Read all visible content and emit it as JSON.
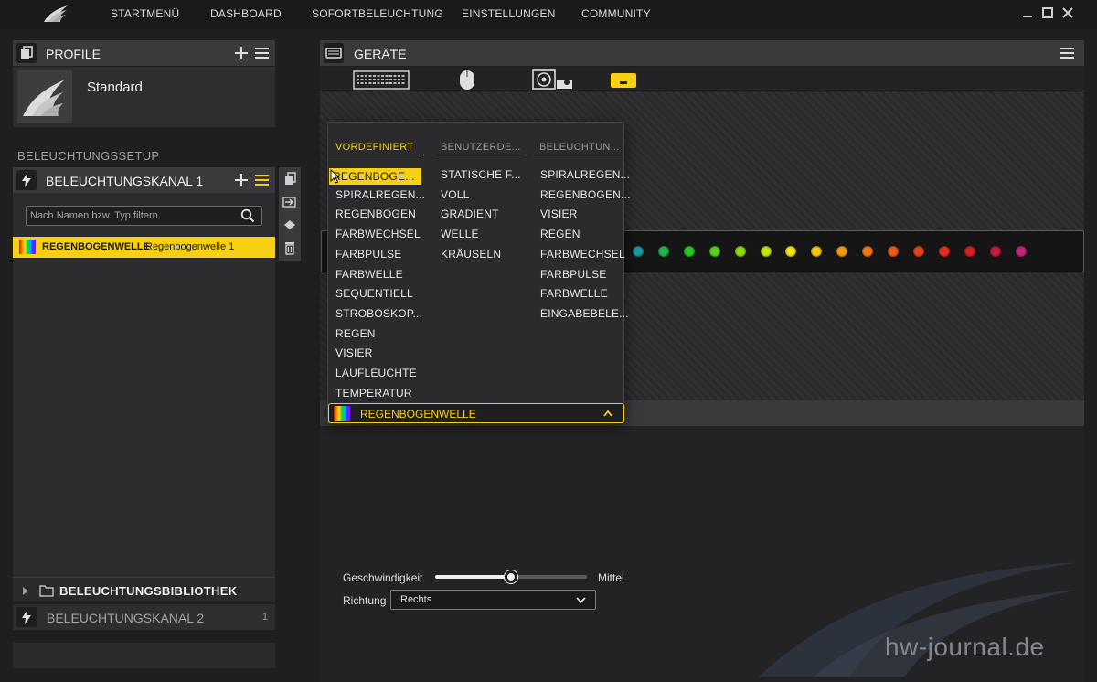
{
  "nav": {
    "items": [
      "STARTMENÜ",
      "DASHBOARD",
      "SOFORTBELEUCHTUNG",
      "EINSTELLUNGEN",
      "COMMUNITY"
    ]
  },
  "profile": {
    "title": "PROFILE",
    "name": "Standard"
  },
  "lighting": {
    "setup_label": "BELEUCHTUNGSSETUP",
    "channel1_title": "BELEUCHTUNGSKANAL 1",
    "filter_placeholder": "Nach Namen bzw. Typ filtern",
    "effect_type": "REGENBOGENWELLE",
    "effect_name": "Regenbogenwelle 1",
    "library_title": "BELEUCHTUNGSBIBLIOTHEK",
    "channel2_title": "BELEUCHTUNGSKANAL 2",
    "channel2_count": "1"
  },
  "devices": {
    "title": "GERÄTE",
    "icons": [
      "keyboard-icon",
      "mouse-icon",
      "fan-cooler-icon",
      "mousepad-icon"
    ],
    "led_colors": [
      "#1a9aa0",
      "#22b64a",
      "#2fc62a",
      "#58d21a",
      "#8ddc12",
      "#c8e20d",
      "#f5e40d",
      "#f7c40f",
      "#f39c12",
      "#f0781a",
      "#ec5a1d",
      "#e8421f",
      "#e2301f",
      "#d81f22",
      "#c81b3d",
      "#c0267a"
    ]
  },
  "dropdown": {
    "columns": [
      {
        "heading": "VORDEFINIERT",
        "items": [
          "REGENBOGE...",
          "SPIRALREGEN...",
          "REGENBOGEN",
          "FARBWECHSEL",
          "FARBPULSE",
          "FARBWELLE",
          "SEQUENTIELL",
          "STROBOSKOP...",
          "REGEN",
          "VISIER",
          "LAUFLEUCHTE",
          "TEMPERATUR"
        ]
      },
      {
        "heading": "BENUTZERDE...",
        "items": [
          "STATISCHE F...",
          "VOLL",
          "GRADIENT",
          "WELLE",
          "KRÄUSELN"
        ]
      },
      {
        "heading": "BELEUCHTUN...",
        "items": [
          "SPIRALREGEN...",
          "REGENBOGEN...",
          "VISIER",
          "REGEN",
          "FARBWECHSEL",
          "FARBPULSE",
          "FARBWELLE",
          "EINGABEBELE..."
        ]
      }
    ],
    "selected_label": "REGENBOGENWELLE"
  },
  "settings": {
    "speed_label": "Geschwindigkeit",
    "speed_value": "Mittel",
    "speed_level": 0.5,
    "direction_label": "Richtung",
    "direction_value": "Rechts"
  },
  "watermark": "hw-journal.de",
  "colors": {
    "accent": "#f7d013"
  }
}
